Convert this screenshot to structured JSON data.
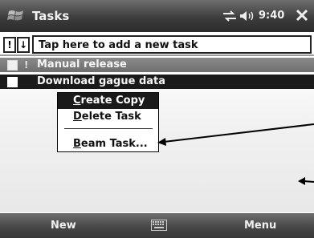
{
  "titlebar": {
    "app_title": "Tasks",
    "clock": "9:40",
    "start_icon": "windows-flag-icon",
    "connectivity_icon": "connectivity-icon",
    "volume_icon": "speaker-icon",
    "close_icon": "close-icon"
  },
  "entrybar": {
    "priority_label": "!",
    "sort_label": "↓",
    "placeholder": "Tap here to add a new task"
  },
  "tasks": [
    {
      "priority_mark": "!",
      "label": "Manual release",
      "checked": false
    },
    {
      "label": "Download gague data",
      "checked": false,
      "selected": true
    }
  ],
  "context_menu": {
    "items": [
      {
        "first": "C",
        "rest": "reate Copy",
        "selected": true
      },
      {
        "first": "D",
        "rest": "elete Task",
        "selected": false
      },
      {
        "first": "B",
        "rest": "eam Task...",
        "selected": false
      }
    ]
  },
  "softkeys": {
    "left": "New",
    "right": "Menu",
    "center_icon": "keyboard-icon"
  },
  "colors": {
    "bar_dark": "#3d3d3d",
    "selection": "#1a1a1a",
    "text_light": "#f2f2f2"
  }
}
